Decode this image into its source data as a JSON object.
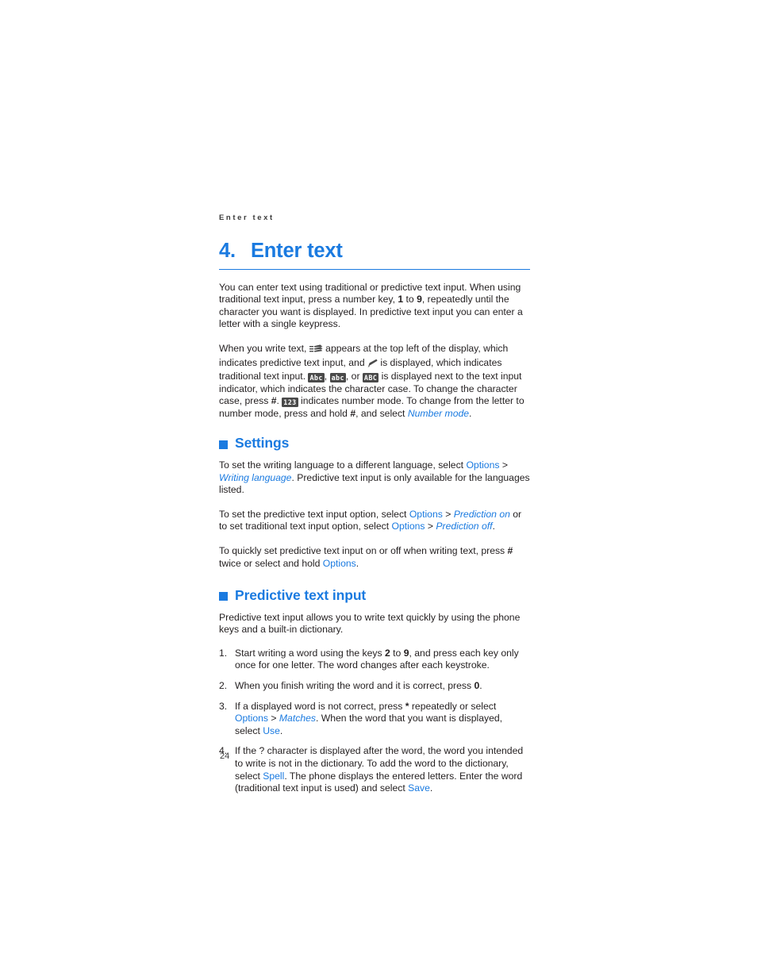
{
  "page": {
    "running_head": "Enter text",
    "folio": "24",
    "accent_color": "#1a7ae0",
    "text_color": "#231f20"
  },
  "chapter": {
    "number": "4.",
    "title": "Enter text"
  },
  "intro": {
    "p1_a": "You can enter text using traditional or predictive text input. When using traditional text input, press a number key, ",
    "p1_key_from": "1",
    "p1_b": " to ",
    "p1_key_to": "9",
    "p1_c": ", repeatedly until the character you want is displayed. In predictive text input you can enter a letter with a single keypress.",
    "p2_a": "When you write text, ",
    "p2_icon_predictive": "predictive-text-indicator-icon",
    "p2_b": " appears at the top left of the display, which indicates predictive text input, and ",
    "p2_icon_traditional": "traditional-text-indicator-icon",
    "p2_c": " is displayed, which indicates traditional text input. ",
    "badge_abc_initial": "Abc",
    "p2_d": ", ",
    "badge_abc_lower": "abc",
    "p2_e": ", or ",
    "badge_abc_upper": "ABC",
    "p2_f": " is displayed next to the text input indicator, which indicates the character case. To change the character case, press ",
    "p2_hash1": "#",
    "p2_g": ". ",
    "badge_123": "123",
    "p2_h": " indicates number mode. To change from the letter to number mode, press and hold ",
    "p2_hash2": "#",
    "p2_i": ", and select ",
    "p2_link_number_mode": "Number mode",
    "p2_j": "."
  },
  "settings": {
    "heading": "Settings",
    "p1_a": "To set the writing language to a different language, select ",
    "p1_options": "Options",
    "p1_gt": " > ",
    "p1_writing_language": "Writing language",
    "p1_b": ". Predictive text input is only available for the languages listed.",
    "p2_a": "To set the predictive text input option, select ",
    "p2_options1": "Options",
    "p2_gt1": " > ",
    "p2_prediction_on": "Prediction on",
    "p2_b": " or to set traditional text input option, select ",
    "p2_options2": "Options",
    "p2_gt2": " > ",
    "p2_prediction_off": "Prediction off",
    "p2_c": ".",
    "p3_a": "To quickly set predictive text input on or off when writing text, press ",
    "p3_hash": "#",
    "p3_b": " twice or select and hold ",
    "p3_options": "Options",
    "p3_c": "."
  },
  "predictive": {
    "heading": "Predictive text input",
    "intro": "Predictive text input allows you to write text quickly by using the phone keys and a built-in dictionary.",
    "steps": [
      {
        "num": "1.",
        "a": "Start writing a word using the keys ",
        "key_from": "2",
        "b": " to ",
        "key_to": "9",
        "c": ", and press each key only once for one letter. The word changes after each keystroke."
      },
      {
        "num": "2.",
        "a": "When you finish writing the word and it is correct, press ",
        "key": "0",
        "b": "."
      },
      {
        "num": "3.",
        "a": "If a displayed word is not correct, press ",
        "star": "*",
        "b": " repeatedly or select ",
        "options": "Options",
        "gt": " > ",
        "matches": "Matches",
        "c": ". When the word that you want is displayed, select ",
        "use": "Use",
        "d": "."
      },
      {
        "num": "4.",
        "a": "If the ? character is displayed after the word, the word you intended to write is not in the dictionary. To add the word to the dictionary, select ",
        "spell": "Spell",
        "b": ". The phone displays the entered letters. Enter the word (traditional text input is used) and select ",
        "save": "Save",
        "c": "."
      }
    ]
  }
}
